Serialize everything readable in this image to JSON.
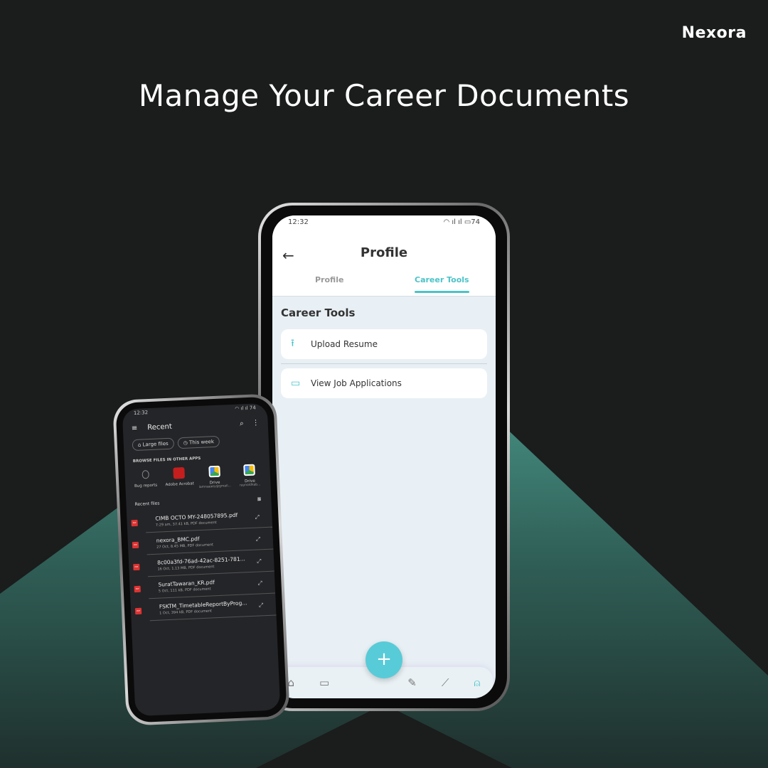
{
  "brand": "Nexora",
  "headline": "Manage Your Career Documents",
  "colors": {
    "accent": "#4cc3c8",
    "fab": "#58cbd8",
    "teal_bg": "#4fa394",
    "dark_bg": "#1b1c1c"
  },
  "main_phone": {
    "status_time": "12:32",
    "battery": "74",
    "title": "Profile",
    "back_icon": "arrow-left-icon",
    "tabs": [
      {
        "label": "Profile",
        "active": false
      },
      {
        "label": "Career Tools",
        "active": true
      }
    ],
    "section_title": "Career Tools",
    "items": [
      {
        "label": "Upload Resume",
        "icon": "upload-icon"
      },
      {
        "label": "View Job Applications",
        "icon": "briefcase-icon"
      }
    ],
    "fab_label": "+",
    "nav": [
      "home-icon",
      "briefcase-icon",
      "resume-icon",
      "trending-icon",
      "profile-icon"
    ],
    "active_nav": "profile-icon"
  },
  "files_phone": {
    "status_time": "12:32",
    "battery": "74",
    "title": "Recent",
    "chips": [
      "Large files",
      "This week"
    ],
    "browse_label": "BROWSE FILES IN OTHER APPS",
    "apps": [
      {
        "name": "Bug reports",
        "sub": ""
      },
      {
        "name": "Adobe Acrobat",
        "sub": ""
      },
      {
        "name": "Drive",
        "sub": "iamraaaey@gmail..."
      },
      {
        "name": "Drive",
        "sub": "raynoldkab..."
      }
    ],
    "recent_label": "Recent files",
    "files": [
      {
        "name": "CIMB OCTO MY-248057895.pdf",
        "meta": "7:29 am, 37.41 kB, PDF document"
      },
      {
        "name": "nexora_BMC.pdf",
        "meta": "27 Oct, 8.45 MB, PDF document"
      },
      {
        "name": "8c00a3fd-76ad-42ac-8251-781...",
        "meta": "16 Oct, 1.13 MB, PDF document"
      },
      {
        "name": "SuratTawaran_KR.pdf",
        "meta": "5 Oct, 111 kB, PDF document"
      },
      {
        "name": "FSKTM_TimetableReportByProg...",
        "meta": "1 Oct, 394 kB, PDF document"
      }
    ]
  }
}
